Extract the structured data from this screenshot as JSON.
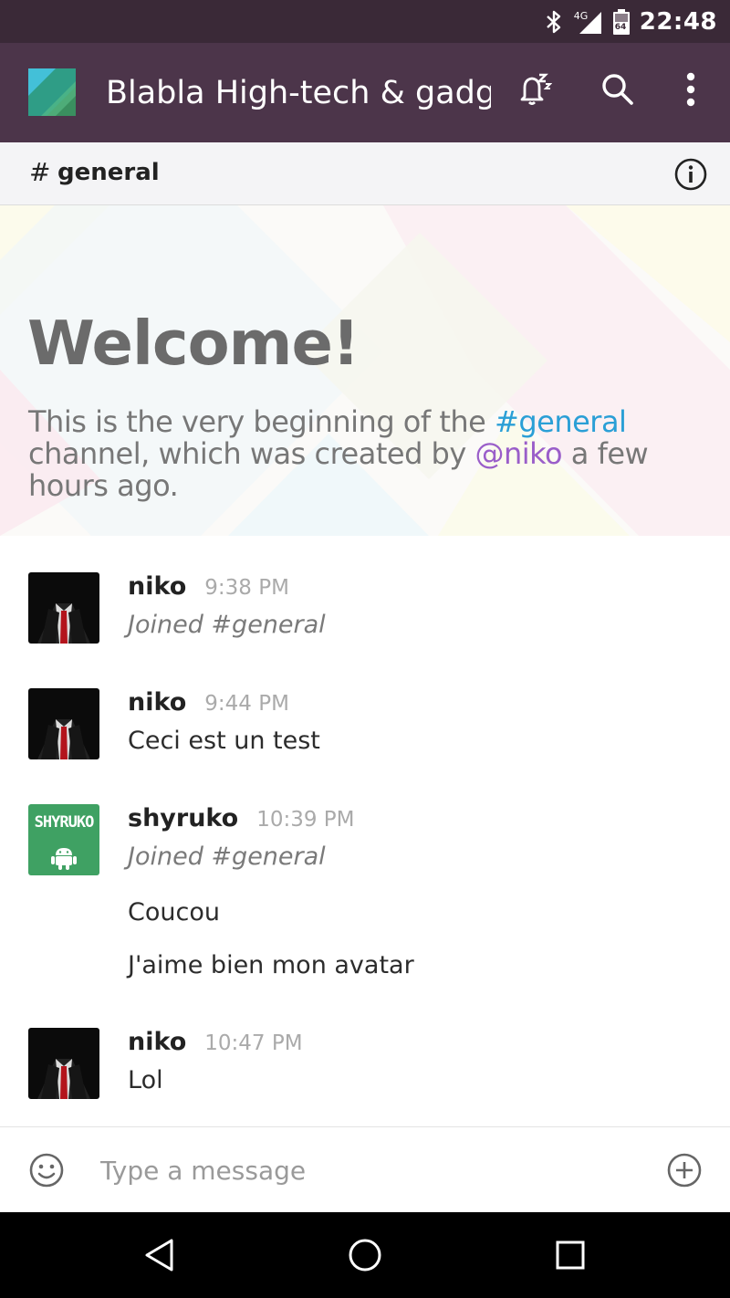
{
  "status_bar": {
    "network": "4G",
    "battery": "64",
    "time": "22:48"
  },
  "app_bar": {
    "title": "Blabla High-tech & gadgets",
    "icons": [
      "app-logo",
      "snooze-bell-icon",
      "search-icon",
      "more-vert-icon"
    ]
  },
  "channel": {
    "hash": "#",
    "name": "general",
    "info_icon": "info-icon"
  },
  "welcome": {
    "title": "Welcome!",
    "text_before": "This is the very beginning of the ",
    "channel_link": "#general",
    "text_middle": " channel, which was created by ",
    "user_link": "@niko",
    "text_after": " a few hours ago."
  },
  "messages": [
    {
      "author": "niko",
      "time": "9:38 PM",
      "lines": [
        "Joined #general"
      ]
    },
    {
      "author": "niko",
      "time": "9:44 PM",
      "lines": [
        "Ceci est un test"
      ]
    },
    {
      "author": "shyruko",
      "time": "10:39 PM",
      "lines": [
        "Joined #general",
        "Coucou",
        "J'aime bien mon avatar"
      ],
      "avatar_text": "SHYRUKO"
    },
    {
      "author": "niko",
      "time": "10:47 PM",
      "lines": [
        "Lol"
      ]
    }
  ],
  "composer": {
    "placeholder": "Type a message",
    "icons": [
      "emoji-icon",
      "add-circle-icon"
    ]
  },
  "nav_bar": {
    "icons": [
      "back-icon",
      "home-icon",
      "recents-icon"
    ]
  },
  "colors": {
    "status_bar": "#3a2937",
    "app_bar": "#4c354a",
    "channel_link": "#2a9fd6",
    "user_link": "#9a5ec9",
    "shyruko_avatar": "#3fa163"
  }
}
